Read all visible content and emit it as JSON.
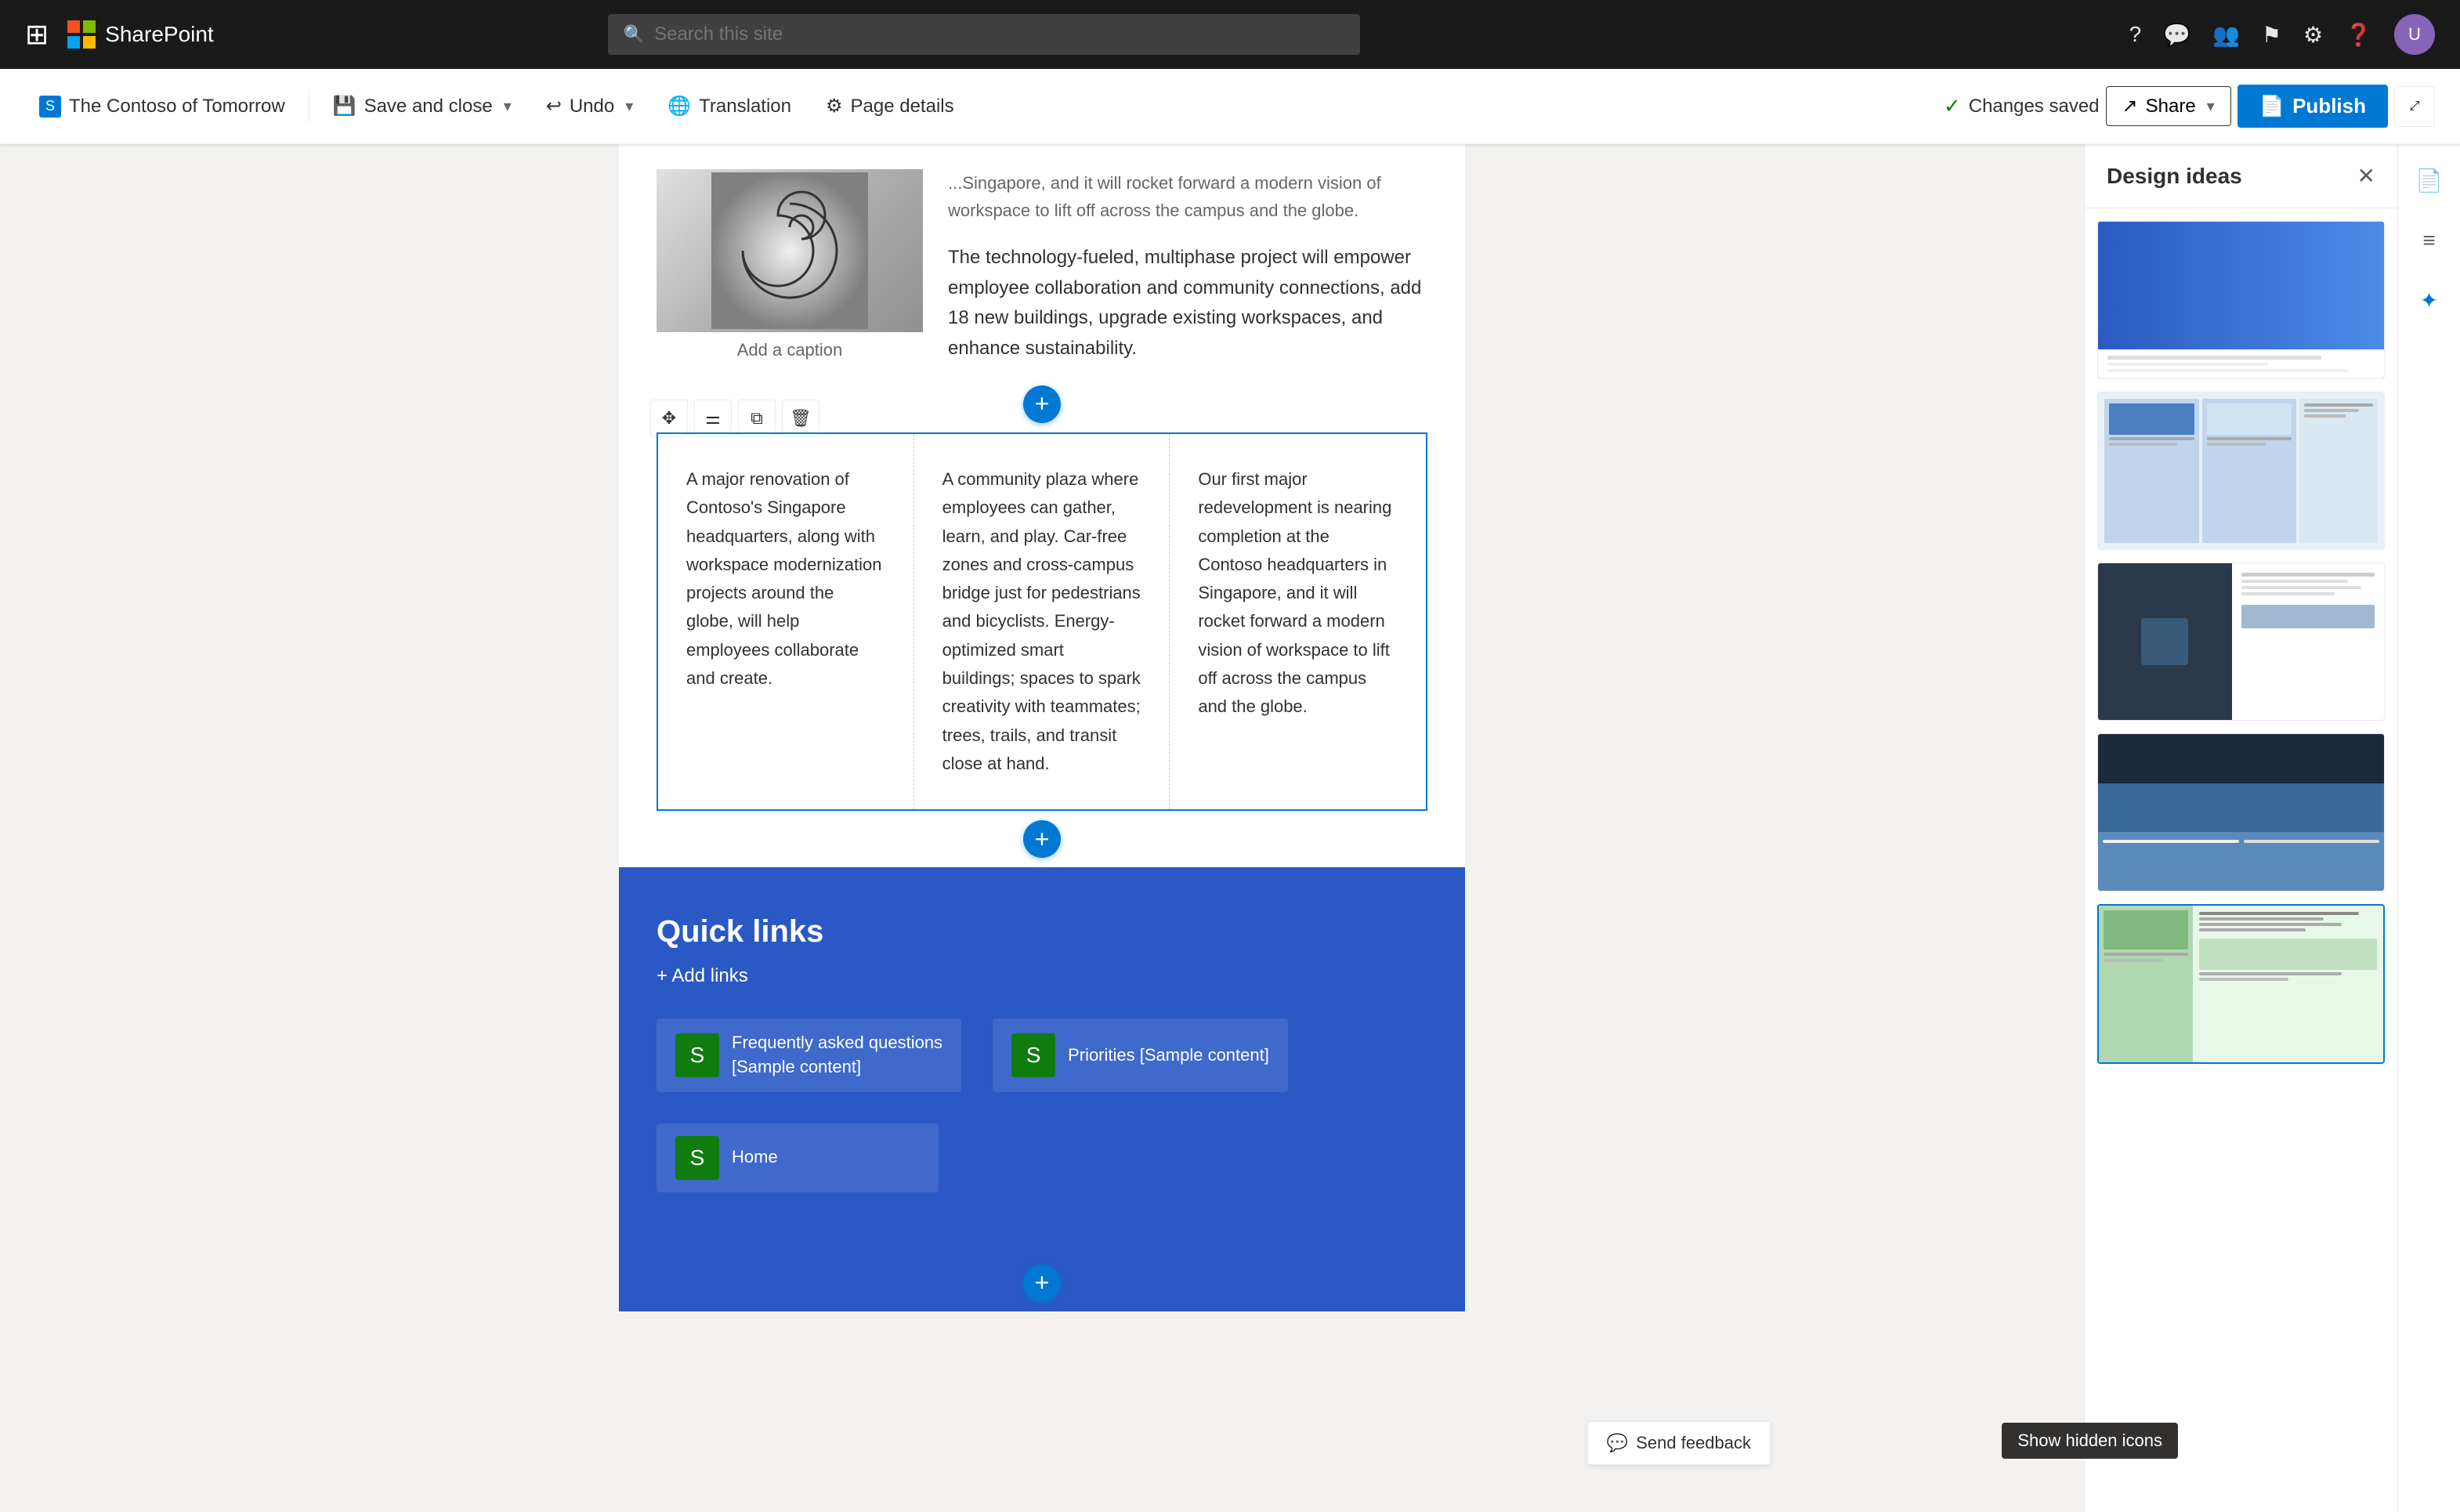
{
  "topNav": {
    "appsIcon": "⊞",
    "appName": "SharePoint",
    "searchPlaceholder": "Search this site",
    "navIcons": [
      "?",
      "💬",
      "👥",
      "⚑",
      "⚙",
      "?"
    ],
    "avatarInitial": "U"
  },
  "editToolbar": {
    "siteLabel": "The Contoso of Tomorrow",
    "saveAndClose": "Save and close",
    "undo": "Undo",
    "translation": "Translation",
    "pageDetails": "Page details",
    "changesSaved": "Changes saved",
    "share": "Share",
    "publish": "Publish"
  },
  "pageContent": {
    "introText1": "campus and the globe.",
    "introText2": "The technology-fueled, multiphase project will empower employee collaboration and community connections, add 18 new buildings, upgrade existing workspaces, and enhance sustainability.",
    "imageCaption": "Add a caption",
    "col1Text": "A major renovation of Contoso's Singapore headquarters, along with workspace modernization projects around the globe, will help employees collaborate and create.",
    "col2Text": "A community plaza where employees can gather, learn, and play. Car-free zones and cross-campus bridge just for pedestrians and bicyclists. Energy-optimized smart buildings; spaces to spark creativity with teammates; trees, trails, and transit close at hand.",
    "col3Text": "Our first major redevelopment is nearing completion at the Contoso headquarters in Singapore, and it will rocket forward a modern vision of workspace to lift off across the campus and the globe.",
    "quickLinks": {
      "title": "Quick links",
      "addLinks": "+ Add links",
      "links": [
        {
          "label": "Frequently asked questions\n[Sample content]"
        },
        {
          "label": "Priorities [Sample content]"
        },
        {
          "label": "Home"
        }
      ]
    }
  },
  "designIdeas": {
    "title": "Design ideas",
    "closeIcon": "✕",
    "cards": [
      {
        "id": "card1",
        "layout": "top-image"
      },
      {
        "id": "card2",
        "layout": "three-col"
      },
      {
        "id": "card3",
        "layout": "two-col"
      },
      {
        "id": "card4",
        "layout": "stacked"
      },
      {
        "id": "card5",
        "layout": "green-featured"
      }
    ]
  },
  "footer": {
    "sendFeedback": "Send feedback",
    "showHiddenIcons": "Show hidden icons"
  },
  "toolbar": {
    "moveIcon": "✥",
    "settingsIcon": "⚌",
    "copyIcon": "⧉",
    "deleteIcon": "🗑"
  }
}
